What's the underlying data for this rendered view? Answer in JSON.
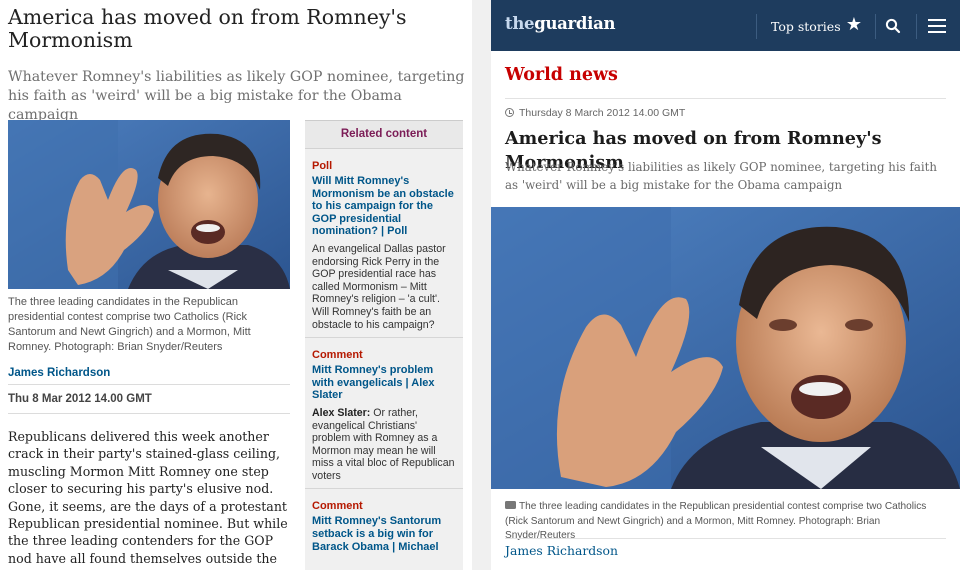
{
  "old_layout": {
    "headline": "America has moved on from Romney's Mormonism",
    "standfirst": "Whatever Romney's liabilities as likely GOP nominee, targeting his faith as 'weird' will be a big mistake for the Obama campaign",
    "photo_alt": "Mitt Romney gesturing while speaking",
    "caption": "The three leading candidates in the Republican presidential contest comprise two Catholics (Rick Santorum and Newt Gingrich) and a Mormon, Mitt Romney. Photograph: Brian Snyder/Reuters",
    "byline": "James Richardson",
    "date": "Thu 8 Mar 2012 14.00 GMT",
    "body": "Republicans delivered this week another crack in their party's stained-glass ceiling, muscling Mormon Mitt Romney one step closer to securing his party's elusive nod. Gone, it seems, are the days of a protestant Republican presidential nominee. But while the three leading contenders for the GOP nod have all found themselves outside the religious",
    "related": {
      "heading": "Related content",
      "items": [
        {
          "kicker": "Poll",
          "title": "Will Mitt Romney's Mormonism be an obstacle to his campaign for the GOP presidential nomination? | Poll",
          "author": "",
          "desc": "An evangelical Dallas pastor endorsing Rick Perry in the GOP presidential race has called Mormonism – Mitt Romney's religion – 'a cult'. Will Romney's faith be an obstacle to his campaign?"
        },
        {
          "kicker": "Comment",
          "title": "Mitt Romney's problem with evangelicals | Alex Slater",
          "author": "Alex Slater:",
          "desc": " Or rather, evangelical Christians' problem with Romney as a Mormon may mean he will miss a vital bloc of Republican voters"
        },
        {
          "kicker": "Comment",
          "title": "Mitt Romney's Santorum setback is a big win for Barack Obama | Michael",
          "author": "",
          "desc": ""
        }
      ]
    }
  },
  "new_layout": {
    "logo_prefix": "the",
    "logo_main": "guardian",
    "nav": {
      "top_stories": "Top stories",
      "star_icon": "★"
    },
    "section": "World news",
    "meta_date": "Thursday 8 March 2012 14.00 GMT",
    "headline": "America has moved on from Romney's Mormonism",
    "standfirst": "Whatever Romney's liabilities as likely GOP nominee, targeting his faith as 'weird' will be a big mistake for the Obama campaign",
    "photo_alt": "Mitt Romney gesturing while speaking",
    "caption": "The three leading candidates in the Republican presidential contest comprise two Catholics (Rick Santorum and Newt Gingrich) and a Mormon, Mitt Romney. Photograph: Brian Snyder/Reuters",
    "byline": "James Richardson"
  },
  "colors": {
    "nav_bg": "#1e3c5e",
    "section_red": "#c70000",
    "link_blue": "#005689",
    "related_purple": "#7b1c56"
  }
}
